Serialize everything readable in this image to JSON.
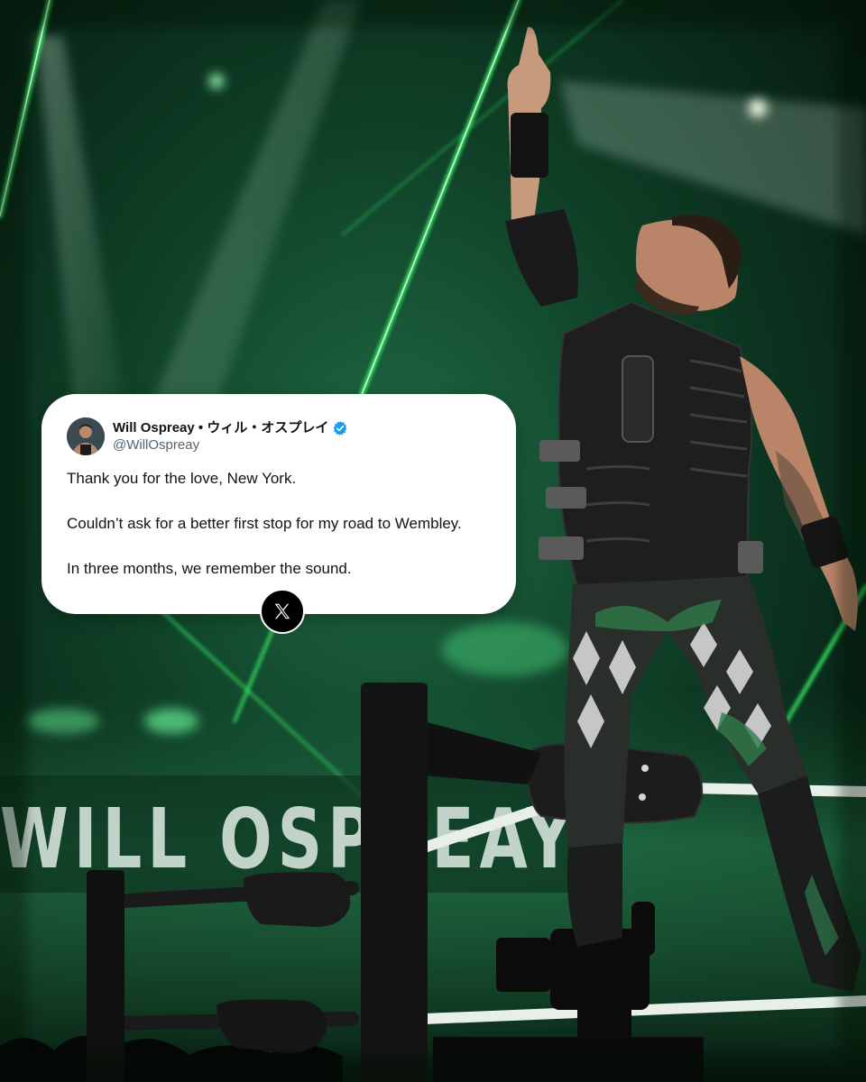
{
  "tweet": {
    "display_name": "Will Ospreay • ウィル・オスプレイ",
    "handle": "@WillOspreay",
    "lines": [
      "Thank you for the love, New York.",
      "Couldn’t ask for a better first stop for my road to Wembley.",
      "In three months, we remember the sound."
    ],
    "verified_icon": "verified-badge-icon",
    "brand_icon": "x-logo-icon"
  },
  "background": {
    "sign_text": "WILL OSPREAY",
    "colors": {
      "laser_green": "#3dff6a",
      "dark_green": "#0a2c1a",
      "ring_post": "#141414",
      "verified_blue": "#1d9bf0"
    }
  }
}
